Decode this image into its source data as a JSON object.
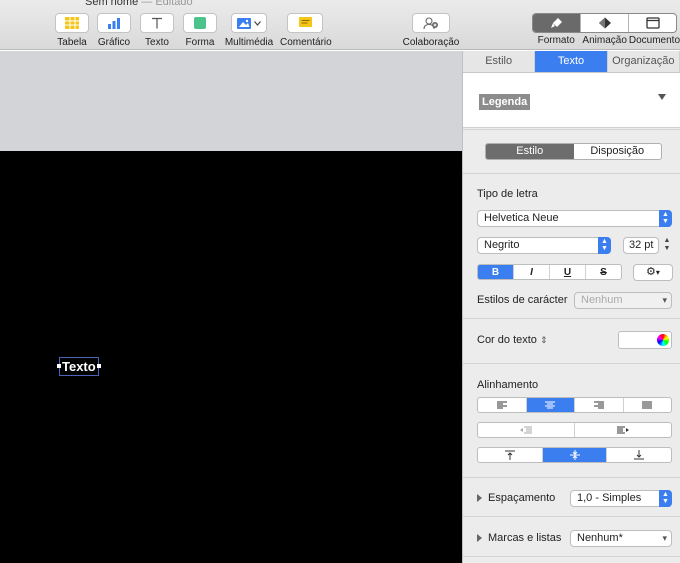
{
  "window": {
    "title": "Sem nome",
    "status": "— Editado"
  },
  "toolbar": {
    "items": [
      {
        "label": "Tabela",
        "icon": "table-icon"
      },
      {
        "label": "Gráfico",
        "icon": "chart-icon"
      },
      {
        "label": "Texto",
        "icon": "text-icon"
      },
      {
        "label": "Forma",
        "icon": "shape-icon"
      },
      {
        "label": "Multimédia",
        "icon": "media-icon"
      },
      {
        "label": "Comentário",
        "icon": "comment-icon"
      },
      {
        "label": "Colaboração",
        "icon": "collaboration-icon"
      }
    ],
    "inspector_modes": [
      {
        "label": "Formato",
        "icon": "format-brush-icon"
      },
      {
        "label": "Animação",
        "icon": "animation-diamond-icon"
      },
      {
        "label": "Documento",
        "icon": "document-icon"
      }
    ],
    "active_mode": "Formato"
  },
  "slide": {
    "text": "Texto"
  },
  "inspector": {
    "tabs": [
      "Estilo",
      "Texto",
      "Organização"
    ],
    "active_tab": "Texto",
    "paragraph_style": "Legenda",
    "sub_tabs": [
      "Estilo",
      "Disposição"
    ],
    "font_section_label": "Tipo de letra",
    "font_family": "Helvetica Neue",
    "font_weight": "Negrito",
    "font_size": "32 pt",
    "format_buttons": [
      "B",
      "I",
      "U",
      "S"
    ],
    "char_styles_label": "Estilos de carácter",
    "char_styles_value": "Nenhum",
    "text_color_label": "Cor do texto",
    "alignment_label": "Alinhamento",
    "spacing_label": "Espaçamento",
    "spacing_value": "1,0 - Simples",
    "bullets_label": "Marcas e listas",
    "bullets_value": "Nenhum*",
    "accent_color": "#3b7ef0"
  }
}
